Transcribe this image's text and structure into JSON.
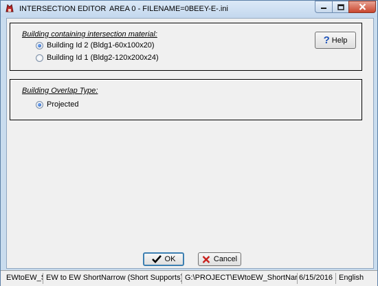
{
  "window": {
    "title": "INTERSECTION EDITOR",
    "area": "AREA 0 - FILENAME=0BEEY-E-.ini",
    "icon": "app-red-icon"
  },
  "building_group": {
    "title": "Building containing intersection material:",
    "options": [
      {
        "label": "Building Id 2 (Bldg1-60x100x20)",
        "checked": true
      },
      {
        "label": "Building Id 1 (Bldg2-120x200x24)",
        "checked": false
      }
    ]
  },
  "overlap_group": {
    "title": "Building Overlap Type:",
    "options": [
      {
        "label": "Projected",
        "checked": true
      }
    ]
  },
  "buttons": {
    "help": "Help",
    "ok": "OK",
    "cancel": "Cancel"
  },
  "statusbar": {
    "cells": [
      "EWtoEW_Sh",
      "EW to EW ShortNarrow (Short Supports)",
      "G:\\PROJECT\\EWtoEW_ShortNarrowS",
      "6/15/2016",
      "English"
    ]
  }
}
